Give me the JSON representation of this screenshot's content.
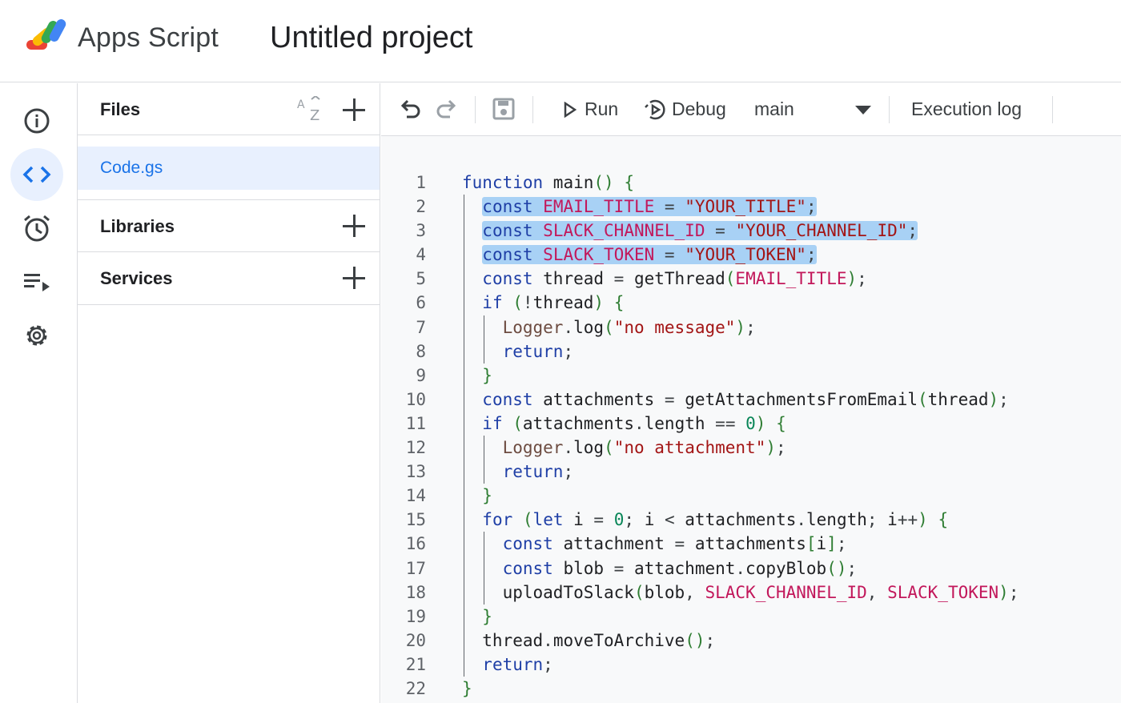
{
  "header": {
    "app_name": "Apps Script",
    "project_title": "Untitled project"
  },
  "rail": {
    "items": [
      "info-icon",
      "code-icon",
      "alarm-icon",
      "executions-icon",
      "settings-icon"
    ]
  },
  "files_panel": {
    "title": "Files",
    "files": [
      "Code.gs"
    ],
    "libraries_label": "Libraries",
    "services_label": "Services"
  },
  "toolbar": {
    "run_label": "Run",
    "debug_label": "Debug",
    "function_select": "main",
    "execution_log_label": "Execution log"
  },
  "editor": {
    "line_numbers": [
      "1",
      "2",
      "3",
      "4",
      "5",
      "6",
      "7",
      "8",
      "9",
      "10",
      "11",
      "12",
      "13",
      "14",
      "15",
      "16",
      "17",
      "18",
      "19",
      "20",
      "21",
      "22"
    ],
    "lines": [
      "function main() {",
      "  const EMAIL_TITLE = \"YOUR_TITLE\";",
      "  const SLACK_CHANNEL_ID = \"YOUR_CHANNEL_ID\";",
      "  const SLACK_TOKEN = \"YOUR_TOKEN\";",
      "  const thread = getThread(EMAIL_TITLE);",
      "  if (!thread) {",
      "    Logger.log(\"no message\");",
      "    return;",
      "  }",
      "  const attachments = getAttachmentsFromEmail(thread);",
      "  if (attachments.length == 0) {",
      "    Logger.log(\"no attachment\");",
      "    return;",
      "  }",
      "  for (let i = 0; i < attachments.length; i++) {",
      "    const attachment = attachments[i];",
      "    const blob = attachment.copyBlob();",
      "    uploadToSlack(blob, SLACK_CHANNEL_ID, SLACK_TOKEN);",
      "  }",
      "  thread.moveToArchive();",
      "  return;",
      "}"
    ]
  }
}
